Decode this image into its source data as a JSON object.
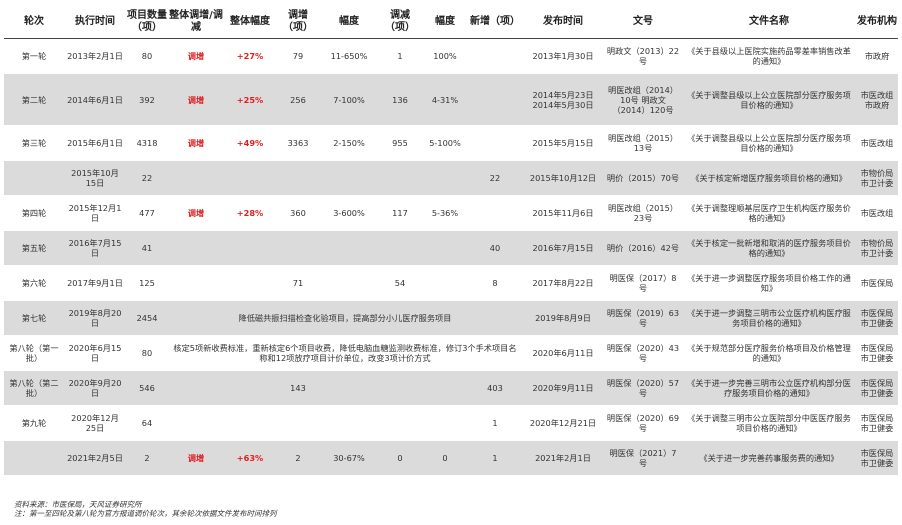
{
  "headers": [
    "轮次",
    "执行时间",
    "项目数量（项）",
    "整体调增/调减",
    "整体幅度",
    "调增（项）",
    "幅度",
    "调减（项）",
    "幅度",
    "新增（项）",
    "发布时间",
    "文号",
    "文件名称",
    "发布机构"
  ],
  "rows": [
    {
      "shade": false,
      "h": 35,
      "cells": [
        "第一轮",
        "2013年2月1日",
        "80",
        "调增",
        "+27%",
        "79",
        "11-650%",
        "1",
        "100%",
        "",
        "2013年1月30日",
        "明政文（2013）22号",
        "《关于县级以上医院实施药品零差率销售改革的通知》",
        "市政府"
      ]
    },
    {
      "shade": true,
      "h": 52,
      "cells": [
        "第二轮",
        "2014年6月1日",
        "392",
        "调增",
        "+25%",
        "256",
        "7-100%",
        "136",
        "4-31%",
        "",
        "2014年5月23日 2014年5月30日",
        "明医改组（2014）10号 明政文（2014）120号",
        "《关于调整县级以上公立医院部分医疗服务项目价格的通知》",
        "市医改组 市政府"
      ]
    },
    {
      "shade": false,
      "h": 35,
      "cells": [
        "第三轮",
        "2015年6月1日",
        "4318",
        "调增",
        "+49%",
        "3363",
        "2-150%",
        "955",
        "5-100%",
        "",
        "2015年5月15日",
        "明医改组（2015）13号",
        "《关于调整县级以上公立医院部分医疗服务项目价格的通知》",
        "市医改组"
      ]
    },
    {
      "shade": true,
      "h": 35,
      "cells": [
        "",
        "2015年10月15日",
        "22",
        "",
        "",
        "",
        "",
        "",
        "",
        "22",
        "2015年10月12日",
        "明价（2015）70号",
        "《关于核定新增医疗服务项目价格的通知》",
        "市物价局 市卫计委"
      ]
    },
    {
      "shade": false,
      "h": 35,
      "cells": [
        "第四轮",
        "2015年12月1日",
        "477",
        "调增",
        "+28%",
        "360",
        "3-600%",
        "117",
        "5-36%",
        "",
        "2015年11月6日",
        "明医改组（2015）23号",
        "《关于调整理顺基层医疗卫生机构医疗服务价格的通知》",
        "市医改组"
      ]
    },
    {
      "shade": true,
      "h": 35,
      "cells": [
        "第五轮",
        "2016年7月15日",
        "41",
        "",
        "",
        "",
        "",
        "",
        "",
        "40",
        "2016年7月15日",
        "明价（2016）42号",
        "《关于核定一批新增和取消的医疗服务项目价格的通知》",
        "市物价局 市卫计委"
      ]
    },
    {
      "shade": false,
      "h": 35,
      "cells": [
        "第六轮",
        "2017年9月1日",
        "125",
        "",
        "",
        "71",
        "",
        "54",
        "",
        "8",
        "2017年8月22日",
        "明医保（2017）8号",
        "《关于进一步调整医疗服务项目价格工作的通知》",
        "市医保局"
      ]
    },
    {
      "shade": true,
      "h": 35,
      "merged": "降低磁共振扫描检查化验项目，提高部分小儿医疗服务项目",
      "cells": [
        "第七轮",
        "2019年8月20日",
        "2454",
        "",
        "",
        "",
        "",
        "",
        "",
        "",
        "2019年8月9日",
        "明医保（2019）63号",
        "《关于进一步调整三明市公立医疗机构医疗服务项目价格的通知》",
        "市医保局 市卫健委"
      ]
    },
    {
      "shade": false,
      "h": 35,
      "merged": "核定5项新收费标准，重新核定6个项目收费，降低电脑血糖监测收费标准，修订3个手术项目名称和12项放疗项目计价单位，改变3项计价方式",
      "cells": [
        "第八轮（第一批）",
        "2020年6月15日",
        "80",
        "",
        "",
        "",
        "",
        "",
        "",
        "12",
        "2020年6月11日",
        "明医保（2020）43号",
        "《关于规范部分医疗服务价格项目及价格管理的通知》",
        "市医保局 市卫健委"
      ]
    },
    {
      "shade": true,
      "h": 35,
      "cells": [
        "第八轮（第二批）",
        "2020年9月20日",
        "546",
        "",
        "",
        "143",
        "",
        "",
        "",
        "403",
        "2020年9月11日",
        "明医保（2020）57号",
        "《关于进一步完善三明市公立医疗机构部分医疗服务项目价格的通知》",
        "市医保局 市卫健委"
      ]
    },
    {
      "shade": false,
      "h": 35,
      "cells": [
        "第九轮",
        "2020年12月25日",
        "64",
        "",
        "",
        "",
        "",
        "",
        "",
        "1",
        "2020年12月21日",
        "明医保（2020）69号",
        "《关于调整三明市公立医院部分中医医疗服务项目价格的通知》",
        "市医保局 市卫健委"
      ]
    },
    {
      "shade": true,
      "h": 35,
      "cells": [
        "",
        "2021年2月5日",
        "2",
        "调增",
        "+63%",
        "2",
        "30-67%",
        "0",
        "0",
        "1",
        "2021年2月1日",
        "明医保（2021）7号",
        "《关于进一步完善药事服务费的通知》",
        "市医保局 市卫健委"
      ]
    }
  ],
  "notes": [
    "资料来源：市医保局，天风证券研究所",
    "注：第一至四轮及第八轮为官方报道调价轮次，其余轮次依据文件发布时间排列"
  ]
}
